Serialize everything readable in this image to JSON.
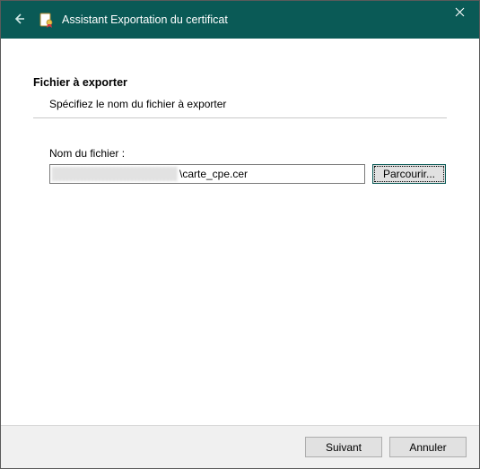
{
  "colors": {
    "titlebar_bg": "#0a5a56",
    "titlebar_fg": "#ffffff",
    "footer_bg": "#f0f0f0",
    "button_bg": "#e1e1e1",
    "focus_border": "#0a5a56"
  },
  "titlebar": {
    "title": "Assistant Exportation du certificat",
    "back_icon": "arrow-left-icon",
    "cert_icon": "certificate-icon",
    "close_icon": "close-icon"
  },
  "page": {
    "heading": "Fichier à exporter",
    "subheading": "Spécifiez le nom du fichier à exporter"
  },
  "filename": {
    "label": "Nom du fichier :",
    "value": "\\carte_cpe.cer",
    "browse_label": "Parcourir..."
  },
  "footer": {
    "next_label": "Suivant",
    "cancel_label": "Annuler"
  }
}
